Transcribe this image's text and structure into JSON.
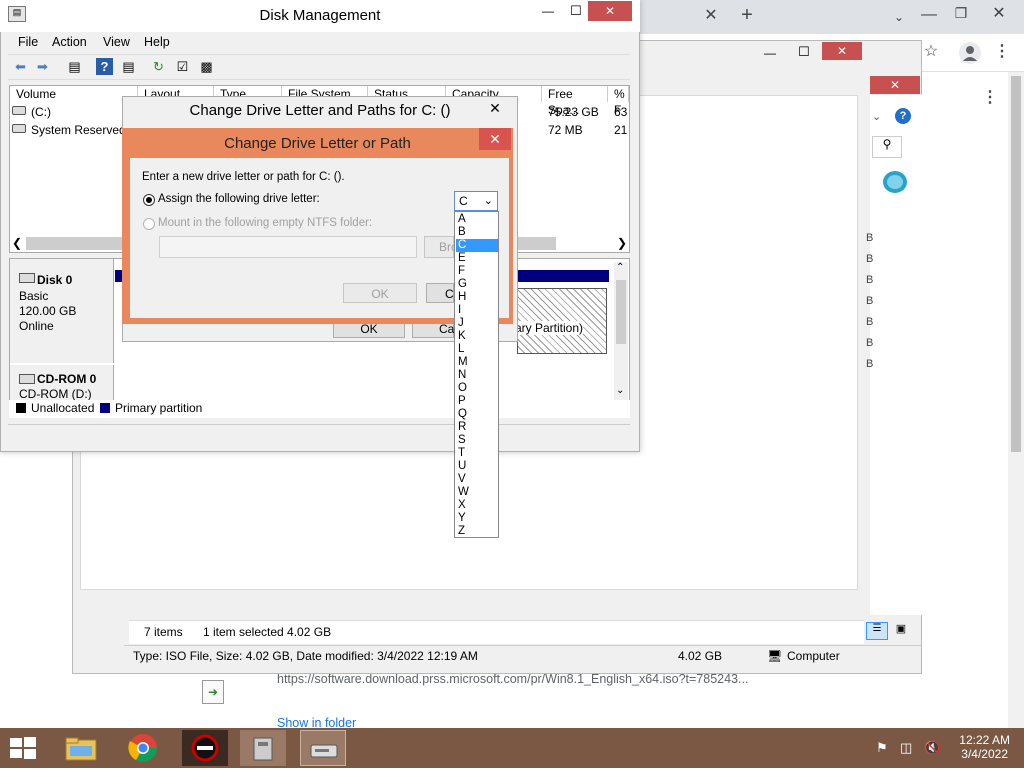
{
  "chrome": {
    "close_tab": "✕",
    "new_tab": "+",
    "menu_dots": "⋮",
    "download_url": "https://software.download.prss.microsoft.com/pr/Win8.1_English_x64.iso?t=785243...",
    "show_in_folder": "Show in folder"
  },
  "explorer": {
    "size_labels": [
      "B",
      "B",
      "B",
      "B",
      "B",
      "B",
      "B"
    ],
    "status_items": "7 items",
    "status_selected": "1 item selected  4.02 GB",
    "details": "Type: ISO File, Size: 4.02 GB, Date modified: 3/4/2022 12:19 AM",
    "details_size": "4.02 GB",
    "details_location": "Computer"
  },
  "disk_mgmt": {
    "title": "Disk Management",
    "menu": [
      "File",
      "Action",
      "View",
      "Help"
    ],
    "columns": [
      "Volume",
      "Layout",
      "Type",
      "File System",
      "Status",
      "Capacity",
      "Free Spa...",
      "% F"
    ],
    "rows": [
      {
        "volume": "(C:)",
        "free": "75.23 GB",
        "pct": "63"
      },
      {
        "volume": "System Reserved",
        "free": "72 MB",
        "pct": "21"
      }
    ],
    "disk0": {
      "name": "Disk 0",
      "type": "Basic",
      "size": "120.00 GB",
      "status": "Online"
    },
    "cdrom0": {
      "name": "CD-ROM 0",
      "drive": "CD-ROM (D:)"
    },
    "partition_text": "ary Partition)",
    "legend_unallocated": "Unallocated",
    "legend_primary": "Primary partition",
    "ok_behind": "OK",
    "cancel_behind": "Ca"
  },
  "dialog_paths": {
    "title": "Change Drive Letter and Paths for C: ()"
  },
  "dialog_letter": {
    "title": "Change Drive Letter or Path",
    "prompt": "Enter a new drive letter or path for C: ().",
    "assign_label": "Assign the following drive letter:",
    "mount_label": "Mount in the following empty NTFS folder:",
    "browse": "Bro",
    "ok": "OK",
    "cancel": "C",
    "selected_letter": "C",
    "letters": [
      "A",
      "B",
      "C",
      "E",
      "F",
      "G",
      "H",
      "I",
      "J",
      "K",
      "L",
      "M",
      "N",
      "O",
      "P",
      "Q",
      "R",
      "S",
      "T",
      "U",
      "V",
      "W",
      "X",
      "Y",
      "Z"
    ]
  },
  "taskbar": {
    "time": "12:22 AM",
    "date": "3/4/2022"
  },
  "colors": {
    "dialog_frame": "#e9885c",
    "taskbar": "#7a5843",
    "selection": "#3399ff",
    "primary_partition": "#00007f"
  }
}
